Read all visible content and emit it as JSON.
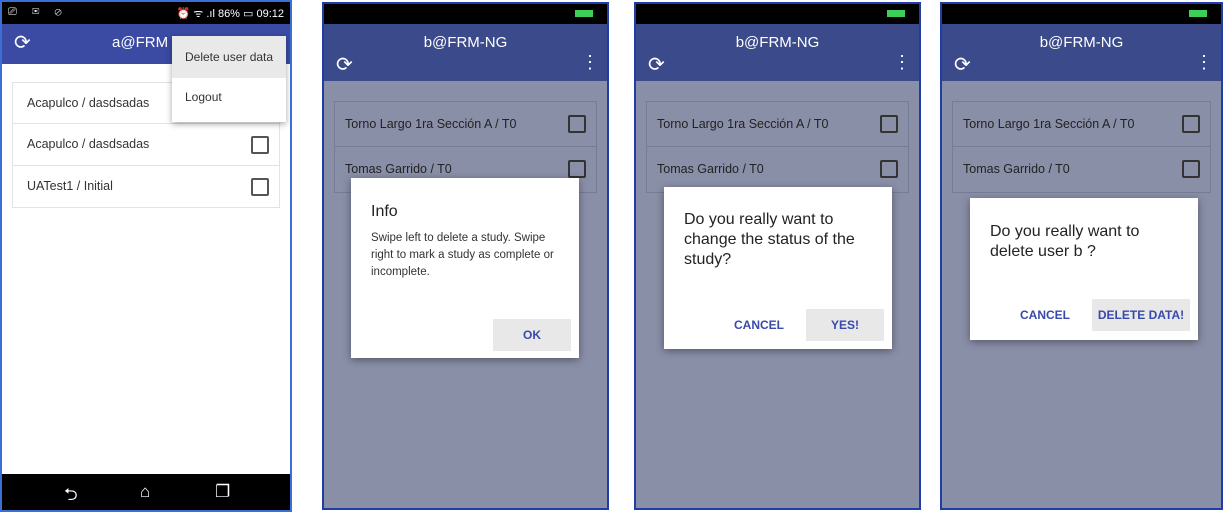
{
  "screen1": {
    "status_left": "⎚ ✉ ⊘",
    "status_right": "⏰ ᯤ .ıl 86% ▭ 09:12",
    "title": "a@FRM",
    "menu": {
      "items": [
        "Delete user data",
        "Logout"
      ]
    },
    "list": [
      {
        "label": "Acapulco / dasdsadas"
      },
      {
        "label": "Acapulco / dasdsadas"
      },
      {
        "label": "UATest1 / Initial"
      }
    ],
    "nav": {
      "back": "⮌",
      "home": "⌂",
      "recent": "❐"
    }
  },
  "screen2": {
    "title": "b@FRM-NG",
    "list": [
      "Torno Largo 1ra Sección A / T0",
      "Tomas Garrido / T0"
    ],
    "dialog": {
      "title": "Info",
      "message": "Swipe left to delete a study. Swipe right to mark a study as complete or incomplete.",
      "ok": "OK"
    }
  },
  "screen3": {
    "title": "b@FRM-NG",
    "list": [
      "Torno Largo 1ra Sección A / T0",
      "Tomas Garrido / T0"
    ],
    "dialog": {
      "title": "Do you really want to change the status of the study?",
      "cancel": "CANCEL",
      "confirm": "YES!"
    }
  },
  "screen4": {
    "title": "b@FRM-NG",
    "list": [
      "Torno Largo 1ra Sección A / T0",
      "Tomas Garrido / T0"
    ],
    "dialog": {
      "title": "Do you really want to delete user b ?",
      "cancel": "CANCEL",
      "confirm": "DELETE DATA!"
    }
  },
  "icons": {
    "sync": "⟳",
    "more": "⋮"
  },
  "colors": {
    "appbar_blue": "#3b4aa3",
    "button_text": "#3949ab",
    "battery_green": "#3dcf58"
  }
}
